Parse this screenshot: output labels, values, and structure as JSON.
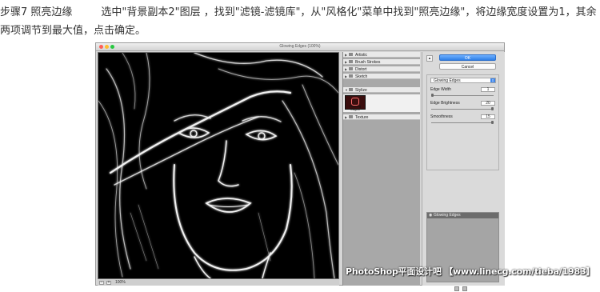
{
  "caption": {
    "step_title": "步骤7 照亮边缘",
    "instruction": "选中\"背景副本2\"图层 ，找到\"滤镜-滤镜库\"，从\"风格化\"菜单中找到\"照亮边缘\"，将边缘宽度设置为1，其余两项调节到最大值，点击确定。"
  },
  "window": {
    "title": "Glowing Edges (100%)",
    "traffic_lights": [
      "#ff5f57",
      "#febc2e",
      "#28c840"
    ]
  },
  "preview": {
    "zoom": "100%",
    "zoom_out": "−",
    "zoom_in": "+"
  },
  "gallery": {
    "folders": [
      {
        "label": "Artistic",
        "expanded": false
      },
      {
        "label": "Brush Strokes",
        "expanded": false
      },
      {
        "label": "Distort",
        "expanded": false
      },
      {
        "label": "Sketch",
        "expanded": false
      },
      {
        "label": "Stylize",
        "expanded": true
      },
      {
        "label": "Texture",
        "expanded": false
      }
    ],
    "stylize_thumb": {
      "label": "Glowing Edges",
      "selected": true
    }
  },
  "controls": {
    "collapse": "▴",
    "ok_label": "OK",
    "cancel_label": "Cancel",
    "filter_select": "Glowing Edges",
    "params": [
      {
        "label": "Edge Width",
        "value": "1",
        "fraction": 0.0
      },
      {
        "label": "Edge Brightness",
        "value": "20",
        "fraction": 1.0
      },
      {
        "label": "Smoothness",
        "value": "15",
        "fraction": 1.0
      }
    ],
    "layer_name": "Glowing Edges"
  },
  "watermark": "PhotoShop平面设计吧 【www.linecg.com/tieba/1983】",
  "colors": {
    "accent_ok": "#2f7fe6",
    "preview_bg": "#000000",
    "panel_bg": "#dadada"
  }
}
